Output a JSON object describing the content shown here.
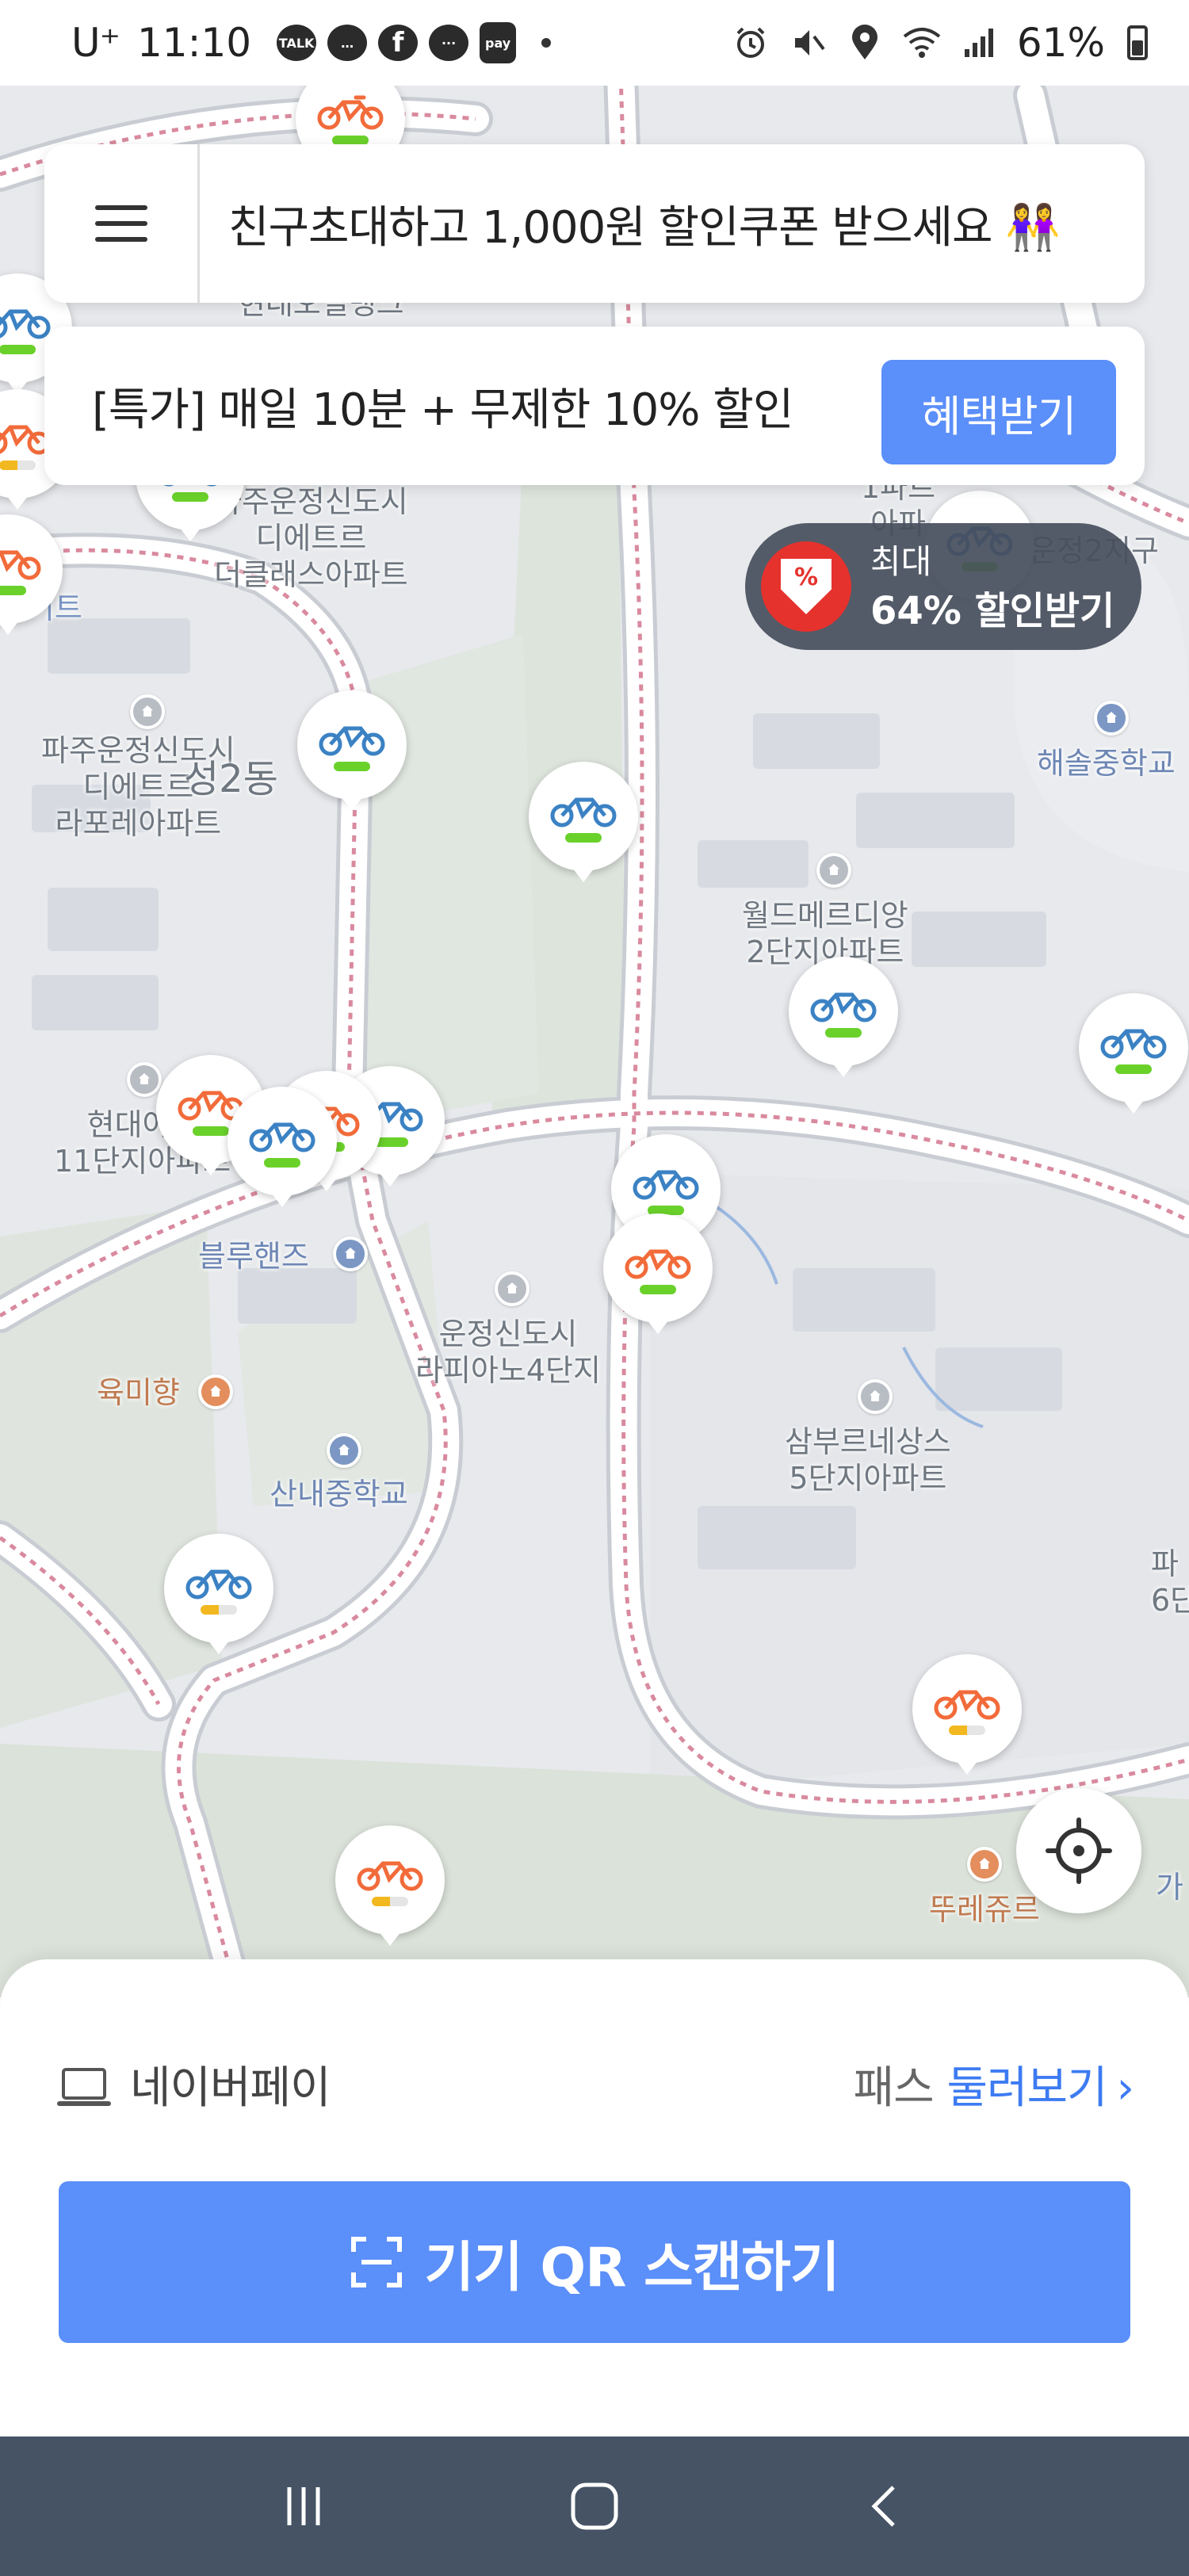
{
  "status_bar": {
    "carrier": "U⁺",
    "time": "11:10",
    "notification_icons": [
      "TALK",
      "talk-alt",
      "facebook",
      "messages",
      "pay"
    ],
    "battery": "61%"
  },
  "top_banner": {
    "text": "친구초대하고 1,000원 할인쿠폰 받으세요 👭"
  },
  "promo_banner": {
    "text": "[특가] 매일 10분 + 무제한 10% 할인",
    "button": "혜택받기"
  },
  "discount_badge": {
    "line1": "최대",
    "line2": "64% 할인받기",
    "icon": "%"
  },
  "map": {
    "labels": [
      "현대오일뱅크",
      "파주운정신도시\n디에트르\n더클래스아파트",
      "파주운정신도시\n디에트르\n라포레아파트",
      "성2동",
      "이트",
      "월드메르디앙\n2단지아파트",
      "운정2지구",
      "해솔중학교",
      "현대아이\n11단지아파트",
      "블루핸즈",
      "운정신도시\n라피아노4단지",
      "육미향",
      "산내중학교",
      "삼부르네상스\n5단지아파트",
      "뚜레쥬르",
      "파\n6단",
      "가",
      "1파트\n아파"
    ]
  },
  "bottom_sheet": {
    "payment_label": "네이버페이",
    "pass_prefix": "패스 ",
    "pass_link": "둘러보기",
    "pass_chevron": "›",
    "qr_button": "기기 QR 스캔하기"
  },
  "colors": {
    "accent": "#5b8ff9",
    "bike_blue": "#3b82c4",
    "bike_orange": "#f26b3a",
    "battery_green": "#6ad12a",
    "battery_yellow": "#f2b820",
    "nav_bar": "#455364"
  }
}
